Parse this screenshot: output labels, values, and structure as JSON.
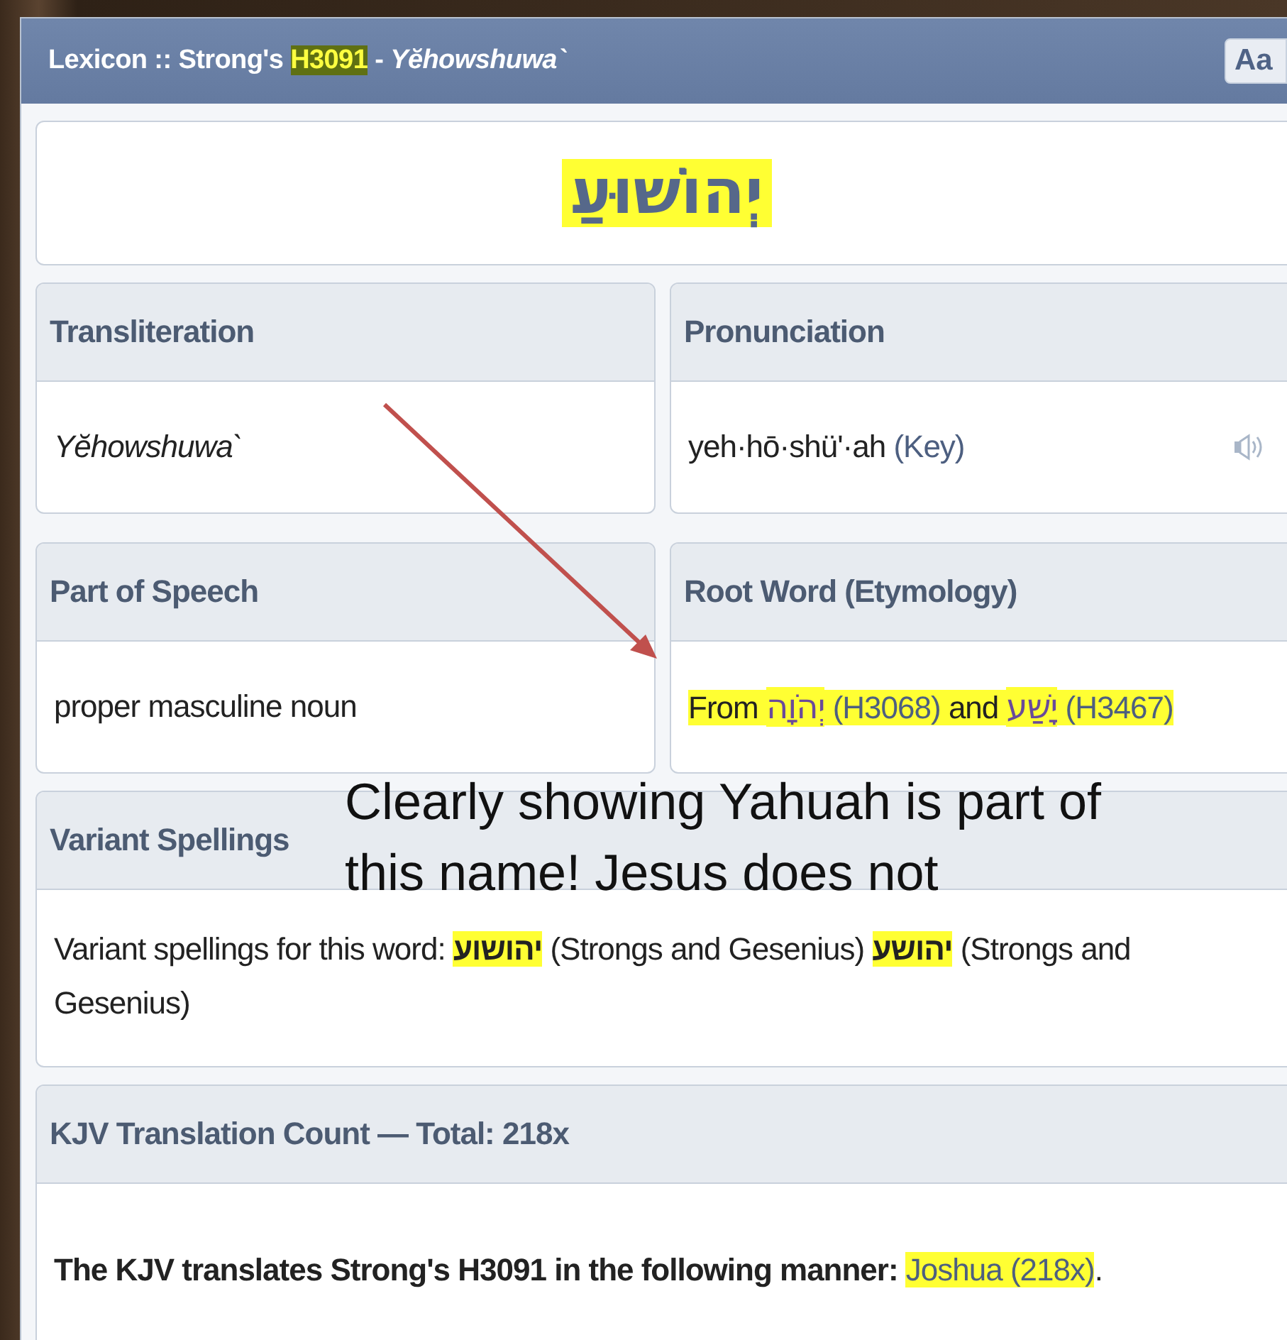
{
  "header": {
    "title": [
      {
        "kind": "text",
        "text": "Lexicon :: Strong's ",
        "highlighted": false
      },
      {
        "kind": "text",
        "text": "H3091",
        "highlighted": true
      },
      {
        "kind": "text",
        "text": " - ",
        "highlighted": false
      },
      {
        "kind": "italic",
        "text": "Yĕhowshuwa`",
        "highlighted": false
      }
    ],
    "font_button": "Aa"
  },
  "headword": {
    "text": "יְהוֹשׁוּעַ",
    "highlighted": true
  },
  "detail_cards": [
    {
      "heading": "Transliteration",
      "audio": false,
      "body": [
        {
          "kind": "italic",
          "text": "Yĕhowshuwa`",
          "highlighted": false
        }
      ]
    },
    {
      "heading": "Pronunciation",
      "audio": true,
      "body": [
        {
          "kind": "text",
          "text": "yeh·hō·shü'·ah ",
          "highlighted": false
        },
        {
          "kind": "link",
          "text": "(Key)",
          "highlighted": false
        }
      ]
    },
    {
      "heading": "Part of Speech",
      "audio": false,
      "body": [
        {
          "kind": "text",
          "text": "proper masculine noun",
          "highlighted": false
        }
      ]
    },
    {
      "heading": "Root Word (Etymology)",
      "audio": false,
      "body": [
        {
          "kind": "text",
          "text": "From ",
          "highlighted": true
        },
        {
          "kind": "hebrew",
          "text": "יְהֹוָה",
          "highlighted": true
        },
        {
          "kind": "link",
          "text": " (H3068) ",
          "highlighted": true
        },
        {
          "kind": "text",
          "text": "and ",
          "highlighted": true
        },
        {
          "kind": "hebrew",
          "text": "יָשַׁע",
          "highlighted": true
        },
        {
          "kind": "link",
          "text": " (H3467)",
          "highlighted": true
        }
      ]
    }
  ],
  "sections": [
    {
      "heading": "Variant Spellings",
      "body": [
        {
          "kind": "text",
          "text": "Variant spellings for this word: ",
          "highlighted": false
        },
        {
          "kind": "bold",
          "text": "יהושוע",
          "highlighted": true
        },
        {
          "kind": "text",
          "text": " (Strongs and Gesenius) ",
          "highlighted": false
        },
        {
          "kind": "bold",
          "text": "יהושע",
          "highlighted": true
        },
        {
          "kind": "text",
          "text": " (Strongs and Gesenius)",
          "highlighted": false
        }
      ]
    },
    {
      "heading": "KJV Translation Count — Total: 218x",
      "body": [
        {
          "kind": "bold",
          "text": "The KJV translates Strong's H3091 in the following manner: ",
          "highlighted": false
        },
        {
          "kind": "link",
          "text": "Joshua (218x)",
          "highlighted": true
        },
        {
          "kind": "text",
          "text": ".",
          "highlighted": false
        }
      ]
    }
  ],
  "annotation": {
    "lines": [
      "Clearly showing Yahuah is part of",
      "this name! Jesus does not"
    ]
  }
}
